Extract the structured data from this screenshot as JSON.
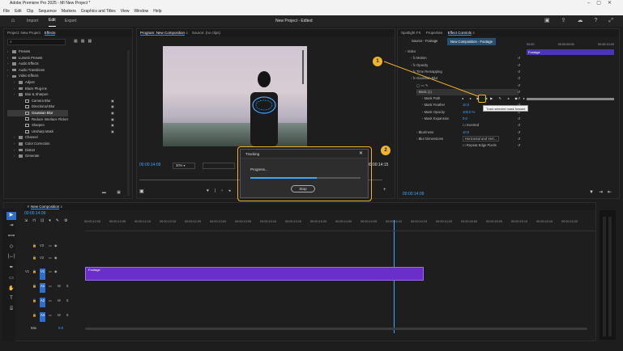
{
  "title": "Adobe Premiere Pro 2025 - MI New Project *",
  "menu": [
    "File",
    "Edit",
    "Clip",
    "Sequence",
    "Markers",
    "Graphics and Titles",
    "View",
    "Window",
    "Help"
  ],
  "app_tabs": [
    "Import",
    "Edit",
    "Export"
  ],
  "center_title": "New Project - Edited",
  "left_panel": {
    "tabs": [
      "Project: New Project",
      "Effects"
    ],
    "tree": [
      {
        "label": "Presets",
        "indent": 0,
        "kind": "folder"
      },
      {
        "label": "Lumetri Presets",
        "indent": 0,
        "kind": "folder"
      },
      {
        "label": "Audio Effects",
        "indent": 0,
        "kind": "folder"
      },
      {
        "label": "Audio Transitions",
        "indent": 0,
        "kind": "folder"
      },
      {
        "label": "Video Effects",
        "indent": 0,
        "kind": "folder"
      },
      {
        "label": "Adjust",
        "indent": 1,
        "kind": "folder"
      },
      {
        "label": "Blaze Plug-ins",
        "indent": 1,
        "kind": "folder"
      },
      {
        "label": "Blur & Sharpen",
        "indent": 1,
        "kind": "folder"
      },
      {
        "label": "Camera Blur",
        "indent": 2,
        "kind": "fx"
      },
      {
        "label": "Directional Blur",
        "indent": 2,
        "kind": "fx"
      },
      {
        "label": "Gaussian Blur",
        "indent": 2,
        "kind": "fx",
        "selected": true
      },
      {
        "label": "Reduce Interlace Flicker",
        "indent": 2,
        "kind": "fx"
      },
      {
        "label": "Sharpen",
        "indent": 2,
        "kind": "fx"
      },
      {
        "label": "Unsharp Mask",
        "indent": 2,
        "kind": "fx"
      },
      {
        "label": "Channel",
        "indent": 1,
        "kind": "folder"
      },
      {
        "label": "Color Correction",
        "indent": 1,
        "kind": "folder"
      },
      {
        "label": "Distort",
        "indent": 1,
        "kind": "folder"
      },
      {
        "label": "Generate",
        "indent": 1,
        "kind": "folder"
      }
    ]
  },
  "program": {
    "tabs": [
      "Program: New Composition",
      "Source: (no clips)"
    ],
    "timecode": "00:00:14:09",
    "zoom": "30%",
    "end_timecode": "00:00:14:15"
  },
  "effect_controls": {
    "tabs": [
      "Spotlight FX",
      "Properties",
      "Effect Controls"
    ],
    "source": "Source - Footage",
    "sequence": "New Composition - Footage",
    "ruler": [
      "00:00",
      "00:00:05:00",
      "00:00:10:00"
    ],
    "clip_label": "Footage",
    "rows": [
      {
        "label": "Video",
        "indent": 0
      },
      {
        "label": "Motion",
        "indent": 1,
        "fx": true
      },
      {
        "label": "Opacity",
        "indent": 1,
        "fx": true
      },
      {
        "label": "Time Remapping",
        "indent": 1,
        "fx": true
      },
      {
        "label": "Gaussian Blur",
        "indent": 1,
        "fx": true
      },
      {
        "label": "",
        "indent": 2,
        "icons": true
      },
      {
        "label": "Mask (1)",
        "indent": 2,
        "selected": true
      },
      {
        "label": "Mask Path",
        "indent": 3
      },
      {
        "label": "Mask Feather",
        "indent": 3,
        "value": "10.0"
      },
      {
        "label": "Mask Opacity",
        "indent": 3,
        "value": "100.0 %"
      },
      {
        "label": "Mask Expansion",
        "indent": 3,
        "value": "0.0"
      },
      {
        "label": "",
        "indent": 3,
        "checkbox": "Inverted"
      },
      {
        "label": "Blurriness",
        "indent": 2,
        "value": "10.0"
      },
      {
        "label": "Blur Dimensions",
        "indent": 2,
        "select": "Horizontal and Vert..."
      },
      {
        "label": "",
        "indent": 2,
        "checkbox": "Repeat Edge Pixels"
      }
    ],
    "tooltip": "Track selected mask forward",
    "footer_timecode": "00:00:14:09"
  },
  "dialog": {
    "title": "Tracking",
    "text": "Progress...",
    "stop": "Stop",
    "progress": 0.6
  },
  "callouts": [
    "1",
    "2"
  ],
  "timeline": {
    "tab": "New Composition",
    "timecode": "00:00:14:09",
    "ruler": [
      "00:00:12:00",
      "00:00:12:05",
      "00:00:12:10",
      "00:00:12:15",
      "00:00:12:20",
      "00:00:13:00",
      "00:00:13:05",
      "00:00:13:10",
      "00:00:13:15",
      "00:00:13:20",
      "00:00:14:00",
      "00:00:14:05",
      "00:00:14:10",
      "00:00:14:15",
      "00:00:14:20",
      "00:00:15:00",
      "00:00:15:05",
      "00:00:15:10",
      "00:00:15:15",
      "00:00:15:20"
    ],
    "video_tracks": [
      "V3",
      "V2",
      "V1"
    ],
    "audio_tracks": [
      "A1",
      "A2",
      "A3"
    ],
    "clip": "Footage",
    "mix": "Mix",
    "mix_value": "0.0",
    "letters": [
      "M",
      "S"
    ]
  }
}
